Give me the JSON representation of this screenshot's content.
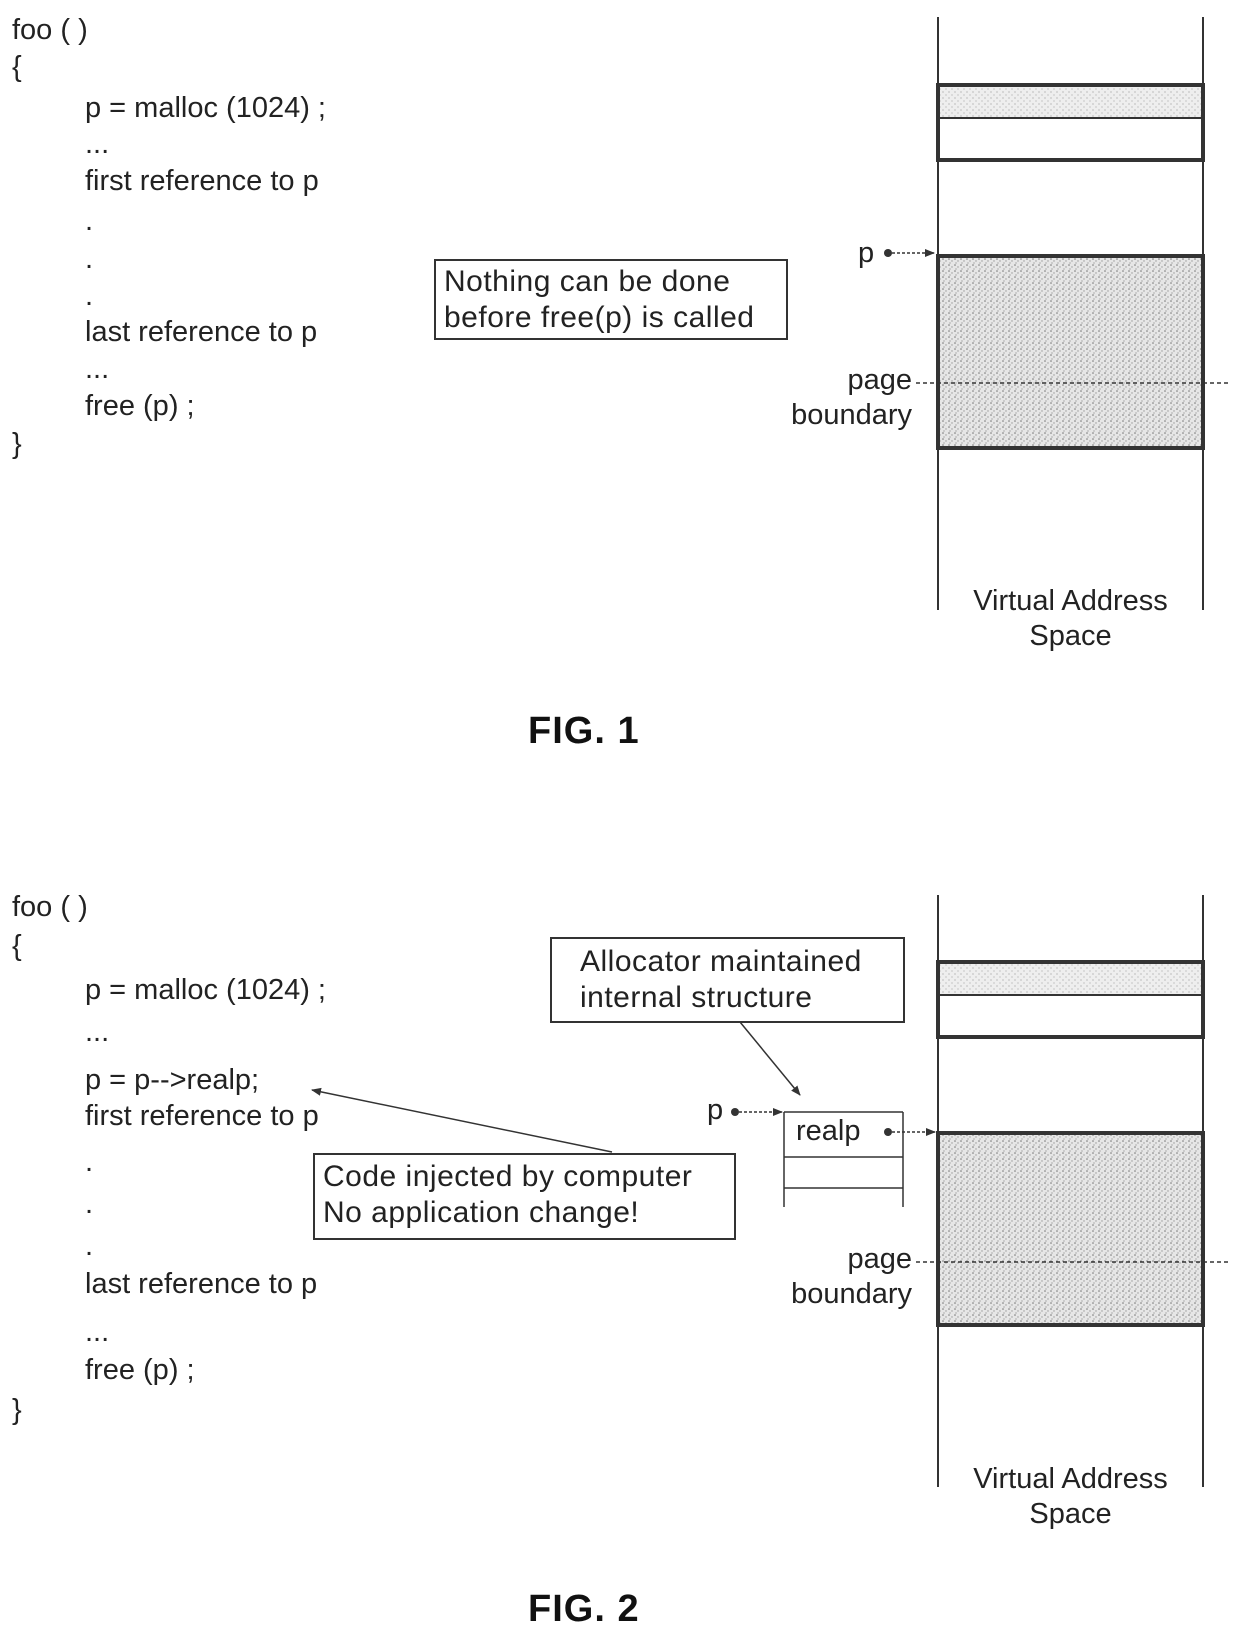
{
  "fig1": {
    "code_lines": [
      "foo ( )",
      "{",
      "p = malloc (1024) ;",
      "...",
      "first reference to p",
      ".",
      ".",
      ".",
      "last reference to p",
      "...",
      "free (p) ;",
      "}"
    ],
    "note_lines": [
      "Nothing can be done",
      "before free(p) is called"
    ],
    "pointer_label": "p",
    "page_boundary_lines": [
      "page",
      "boundary"
    ],
    "vas_label_lines": [
      "Virtual Address",
      "Space"
    ],
    "caption": "FIG. 1"
  },
  "fig2": {
    "code_lines": [
      "foo ( )",
      "{",
      "p = malloc (1024) ;",
      "...",
      "p = p-->realp;",
      "first reference to p",
      ".",
      ".",
      ".",
      "last reference to p",
      "...",
      "free (p) ;",
      "}"
    ],
    "allocator_note_lines": [
      "Allocator maintained",
      "internal structure"
    ],
    "injected_note_lines": [
      "Code injected by computer",
      "No application change!"
    ],
    "pointer_label": "p",
    "struct_field": "realp",
    "page_boundary_lines": [
      "page",
      "boundary"
    ],
    "vas_label_lines": [
      "Virtual Address",
      "Space"
    ],
    "caption": "FIG. 2"
  },
  "colors": {
    "ink": "#222222",
    "shade": "#cfcfcf"
  }
}
